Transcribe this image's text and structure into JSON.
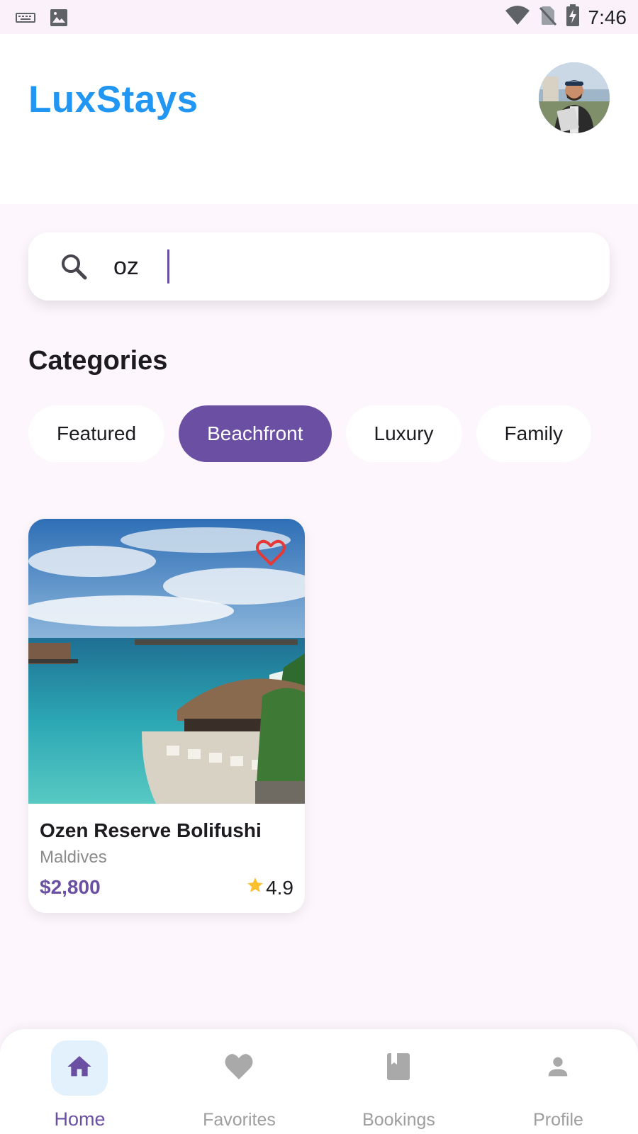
{
  "status_bar": {
    "time": "7:46",
    "icons": [
      "keyboard-icon",
      "image-icon",
      "wifi-icon",
      "no-sim-icon",
      "battery-charging-icon"
    ]
  },
  "header": {
    "app_title": "LuxStays",
    "avatar_icon": "user-avatar-photo"
  },
  "search": {
    "value": "oz",
    "icon": "search-icon"
  },
  "categories": {
    "title": "Categories",
    "items": [
      {
        "label": "Featured",
        "selected": false
      },
      {
        "label": "Beachfront",
        "selected": true
      },
      {
        "label": "Luxury",
        "selected": false
      },
      {
        "label": "Family",
        "selected": false
      }
    ]
  },
  "listing": {
    "name": "Ozen Reserve Bolifushi",
    "location": "Maldives",
    "price": "$2,800",
    "rating": "4.9",
    "favorite_icon": "heart-outline-icon",
    "rating_icon": "star-icon"
  },
  "bottom_nav": {
    "items": [
      {
        "label": "Home",
        "icon": "home-icon",
        "active": true
      },
      {
        "label": "Favorites",
        "icon": "heart-icon",
        "active": false
      },
      {
        "label": "Bookings",
        "icon": "book-icon",
        "active": false
      },
      {
        "label": "Profile",
        "icon": "person-icon",
        "active": false
      }
    ]
  },
  "colors": {
    "brand_blue": "#2196f3",
    "accent_purple": "#6a4fa3",
    "background": "#fdf7fd",
    "favorite_red": "#e53935",
    "star_gold": "#fbc02d"
  }
}
